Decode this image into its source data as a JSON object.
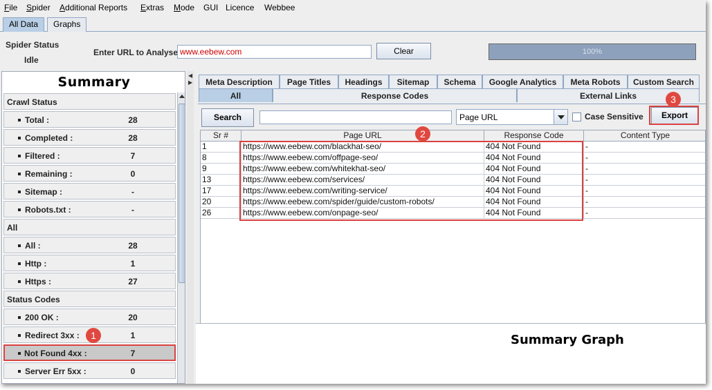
{
  "menu": [
    {
      "label": "File",
      "mnemonic": "F",
      "rest": "ile"
    },
    {
      "label": "Spider",
      "mnemonic": "S",
      "rest": "pider"
    },
    {
      "label": "Additional Reports",
      "mnemonic": "A",
      "rest": "dditional Reports"
    },
    {
      "label": "Extras",
      "mnemonic": "E",
      "rest": "xtras"
    },
    {
      "label": "Mode",
      "mnemonic": "M",
      "rest": "ode"
    },
    {
      "label": "GUI",
      "mnemonic": "",
      "rest": "GUI"
    },
    {
      "label": "Licence",
      "mnemonic": "",
      "rest": "Licence"
    },
    {
      "label": "Webbee",
      "mnemonic": "",
      "rest": "Webbee"
    }
  ],
  "top_tabs": [
    "All Data",
    "Graphs"
  ],
  "spider_status": {
    "label": "Spider Status",
    "value": "Idle"
  },
  "url_bar": {
    "label": "Enter URL to Analyse",
    "value": "www.eebew.com",
    "clear_label": "Clear"
  },
  "progress": {
    "value": 100,
    "label": "100%"
  },
  "summary": {
    "title": "Summary",
    "rows": [
      {
        "label": "Crawl Status",
        "type": "header"
      },
      {
        "label": "Total :",
        "value": "28",
        "type": "item"
      },
      {
        "label": "Completed :",
        "value": "28",
        "type": "item"
      },
      {
        "label": "Filtered :",
        "value": "7",
        "type": "item"
      },
      {
        "label": "Remaining :",
        "value": "0",
        "type": "item"
      },
      {
        "label": "Sitemap :",
        "value": "-",
        "type": "item"
      },
      {
        "label": "Robots.txt :",
        "value": "-",
        "type": "item"
      },
      {
        "label": "All",
        "type": "header"
      },
      {
        "label": "All :",
        "value": "28",
        "type": "item"
      },
      {
        "label": "Http :",
        "value": "1",
        "type": "item"
      },
      {
        "label": "Https :",
        "value": "27",
        "type": "item"
      },
      {
        "label": "Status Codes",
        "type": "header"
      },
      {
        "label": "200 OK :",
        "value": "20",
        "type": "item"
      },
      {
        "label": "Redirect 3xx :",
        "value": "1",
        "type": "item"
      },
      {
        "label": "Not Found 4xx :",
        "value": "7",
        "type": "item",
        "selected": true
      },
      {
        "label": "Server Err 5xx :",
        "value": "0",
        "type": "item"
      }
    ]
  },
  "report_tabs_row1": [
    "Meta Description",
    "Page Titles",
    "Headings",
    "Sitemap",
    "Schema",
    "Google Analytics",
    "Meta Robots",
    "Custom Search"
  ],
  "report_tabs_row2": [
    "All",
    "Response Codes",
    "External Links"
  ],
  "search": {
    "button_label": "Search",
    "query": "",
    "filter_selected": "Page URL",
    "case_sensitive_label": "Case Sensitive",
    "export_label": "Export"
  },
  "table": {
    "columns": [
      "Sr #",
      "Page URL",
      "Response Code",
      "Content Type"
    ],
    "rows": [
      [
        "1",
        "https://www.eebew.com/blackhat-seo/",
        "404 Not Found",
        "-"
      ],
      [
        "8",
        "https://www.eebew.com/offpage-seo/",
        "404 Not Found",
        "-"
      ],
      [
        "9",
        "https://www.eebew.com/whitekhat-seo/",
        "404 Not Found",
        "-"
      ],
      [
        "13",
        "https://www.eebew.com/services/",
        "404 Not Found",
        "-"
      ],
      [
        "17",
        "https://www.eebew.com/writing-service/",
        "404 Not Found",
        "-"
      ],
      [
        "20",
        "https://www.eebew.com/spider/guide/custom-robots/",
        "404 Not Found",
        "-"
      ],
      [
        "26",
        "https://www.eebew.com/onpage-seo/",
        "404 Not Found",
        "-"
      ]
    ]
  },
  "summary_graph_title": "Summary Graph",
  "annotations": [
    "1",
    "2",
    "3"
  ],
  "colors": {
    "accent_red": "#d9413f",
    "tab_active": "#b8cfe5",
    "url_text": "#cc0000"
  }
}
